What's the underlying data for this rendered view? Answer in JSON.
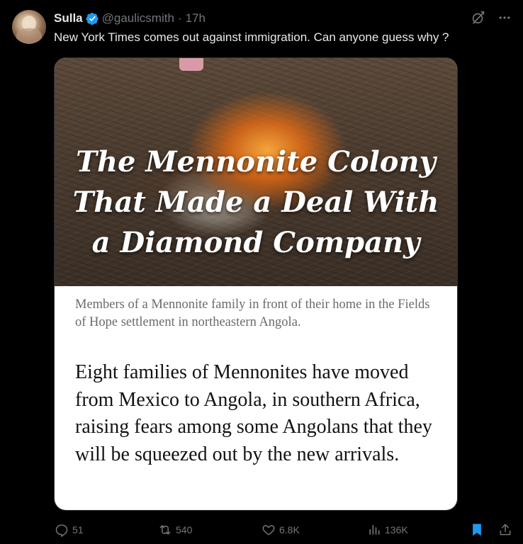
{
  "author": {
    "name": "Sulla",
    "handle": "@gaulicsmith",
    "separator": "·",
    "time": "17h"
  },
  "tweet_text": "New York Times comes out against immigration. Can anyone guess why ?",
  "card": {
    "headline_lines": [
      "The Mennonite Colony",
      "That Made a Deal With",
      "a Diamond Company"
    ],
    "caption": "Members of a Mennonite family in front of their home in the Fields of Hope settlement in northeastern Angola.",
    "summary": "Eight families of Mennonites have moved from Mexico to Angola, in southern Africa, raising fears among some Angolans that they will be squeezed out by the new arrivals."
  },
  "metrics": {
    "replies": "51",
    "reposts": "540",
    "likes": "6.8K",
    "views": "136K"
  },
  "colors": {
    "background": "#000000",
    "text": "#e7e9ea",
    "muted": "#71767b",
    "verified": "#1d9bf0",
    "bookmark_active": "#1d9bf0"
  },
  "icons": {
    "verified": "verified-badge-icon",
    "grok": "grok-icon",
    "more": "more-icon",
    "reply": "reply-icon",
    "repost": "repost-icon",
    "like": "like-icon",
    "views": "views-icon",
    "bookmark": "bookmark-icon",
    "share": "share-icon"
  }
}
